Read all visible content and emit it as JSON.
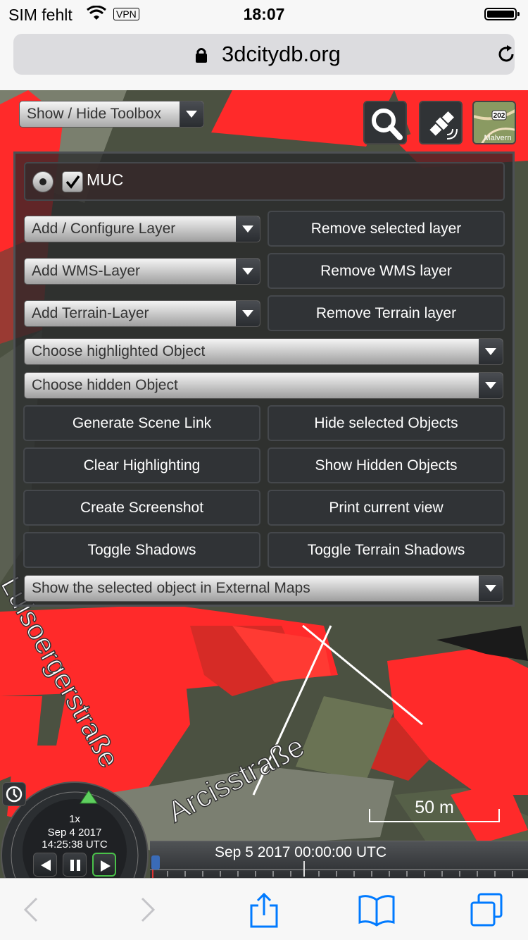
{
  "status_bar": {
    "carrier": "SIM fehlt",
    "vpn": "VPN",
    "time": "18:07"
  },
  "browser": {
    "domain": "3dcitydb.org"
  },
  "toolbox": {
    "toggle_label": "Show / Hide Toolbox",
    "layer_name": "MUC",
    "add_layer": "Add / Configure Layer",
    "remove_layer": "Remove selected layer",
    "add_wms": "Add WMS-Layer",
    "remove_wms": "Remove WMS layer",
    "add_terrain": "Add Terrain-Layer",
    "remove_terrain": "Remove Terrain layer",
    "choose_highlighted": "Choose highlighted Object",
    "choose_hidden": "Choose hidden Object",
    "generate_link": "Generate Scene Link",
    "hide_selected": "Hide selected Objects",
    "clear_highlighting": "Clear Highlighting",
    "show_hidden": "Show Hidden Objects",
    "create_screenshot": "Create Screenshot",
    "print_view": "Print current view",
    "toggle_shadows": "Toggle Shadows",
    "toggle_terrain_shadows": "Toggle Terrain Shadows",
    "external_maps": "Show the selected object in External Maps"
  },
  "base_layer": {
    "label": "Malvern",
    "badge": "202"
  },
  "map_labels": {
    "street1": "Arcisstraße",
    "street2": "Luisoergerstraße"
  },
  "animation": {
    "speed": "1x",
    "date": "Sep 4 2017",
    "time": "14:25:38 UTC"
  },
  "timeline": {
    "label": "Sep 5 2017 00:00:00 UTC"
  },
  "scale": {
    "label": "50 m"
  },
  "colors": {
    "roof_red": "#ff2a2a",
    "panel_dark": "#303336",
    "ios_blue": "#007aff"
  }
}
